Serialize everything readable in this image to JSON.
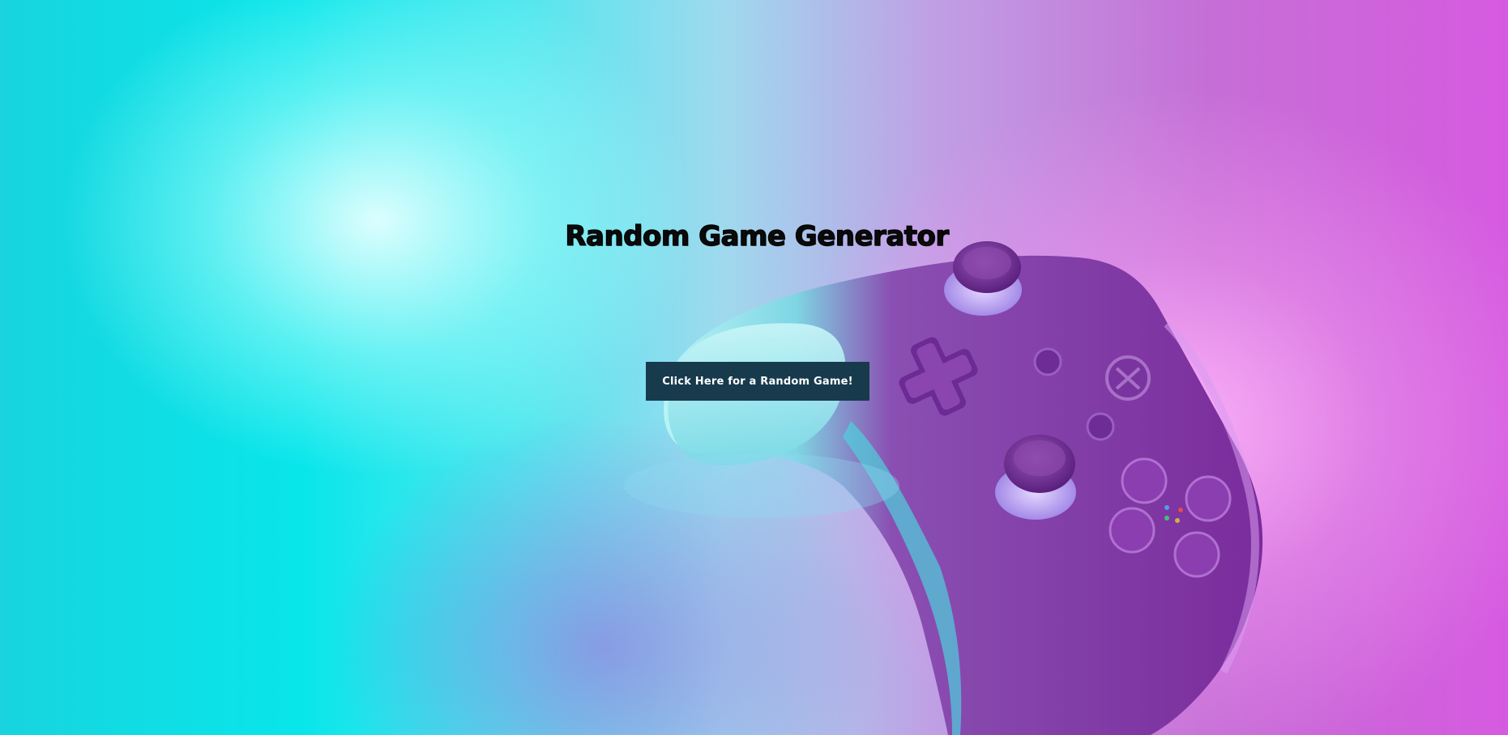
{
  "page": {
    "title": "Random Game Generator",
    "button_label": "Click Here for a Random Game!"
  },
  "colors": {
    "background_left": "#08e6ea",
    "background_right": "#d65ae0",
    "controller": "#7a2fa0",
    "button_bg": "#173a4d",
    "button_text": "#ffffff",
    "title_text": "#0a0a0a"
  },
  "background_image": {
    "icon": "gamepad-controller-photo"
  }
}
